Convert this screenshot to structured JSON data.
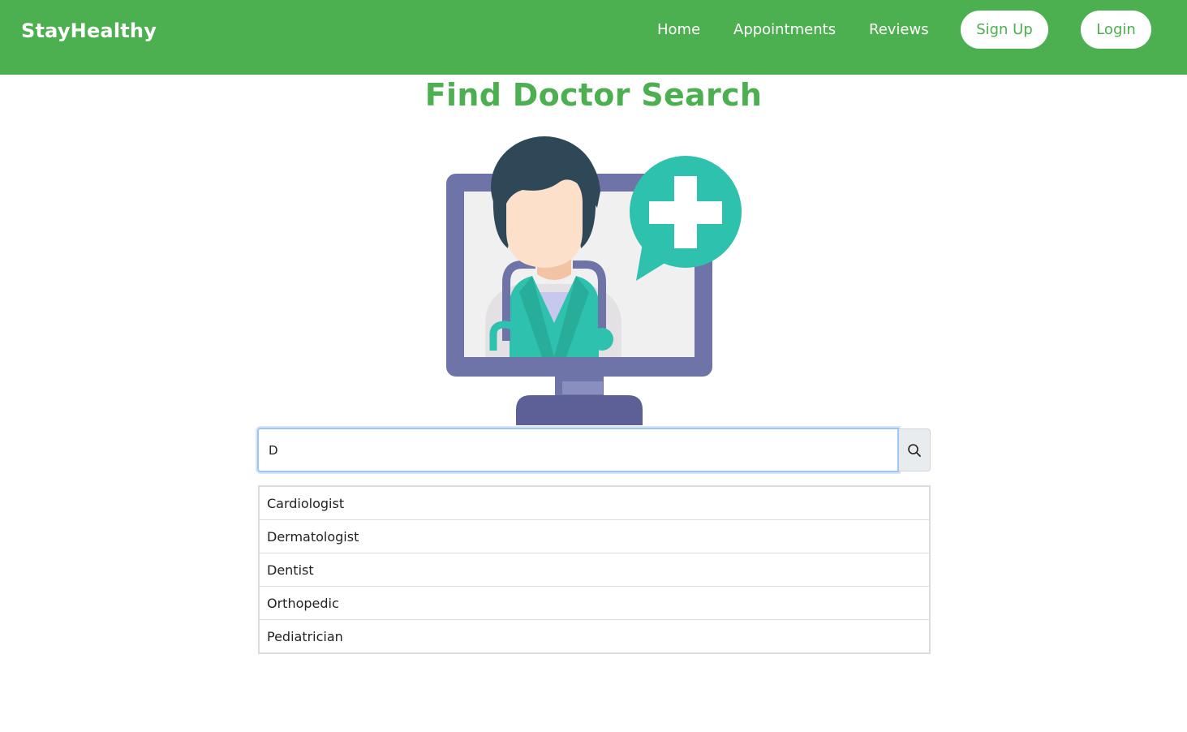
{
  "navbar": {
    "brand": "StayHealthy",
    "links": [
      "Home",
      "Appointments",
      "Reviews"
    ],
    "signup_label": "Sign Up",
    "login_label": "Login"
  },
  "colors": {
    "brand_green": "#4caf50",
    "focus_blue": "#9fc6f0"
  },
  "main": {
    "title": "Find Doctor Search",
    "illustration_icon": "doctor-telemedicine-illustration"
  },
  "search": {
    "value": "D",
    "button_icon": "search-icon"
  },
  "suggestions": [
    "Cardiologist",
    "Dermatologist",
    "Dentist",
    "Orthopedic",
    "Pediatrician"
  ]
}
